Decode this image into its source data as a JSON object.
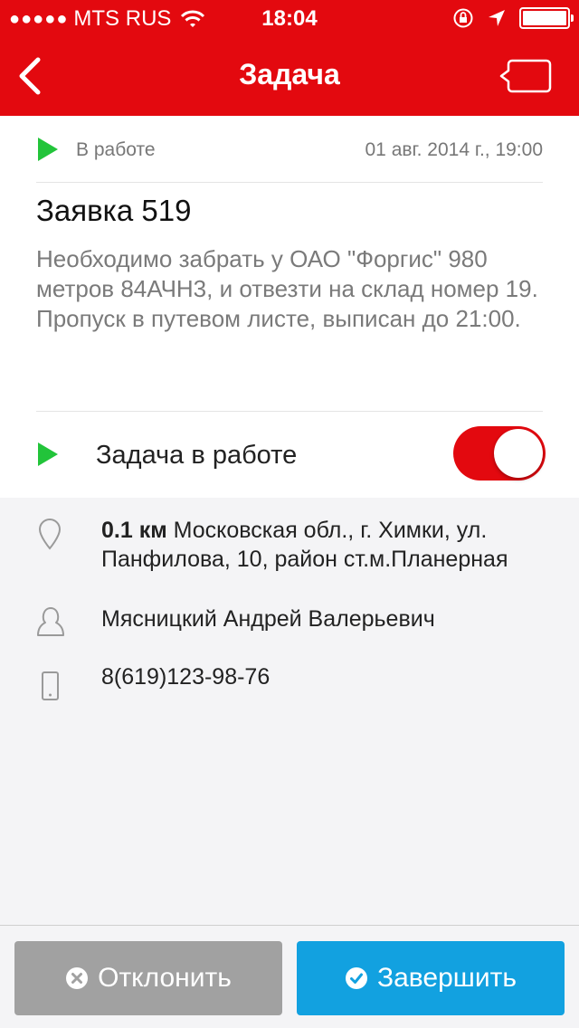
{
  "statusbar": {
    "signal": "●●●●●",
    "carrier": "MTS RUS",
    "time": "18:04"
  },
  "nav": {
    "title": "Задача"
  },
  "task": {
    "status": "В работе",
    "date": "01 авг. 2014 г., 19:00",
    "title": "Заявка 519",
    "description": "Необходимо забрать у ОАО \"Форгис\" 980 метров 84АЧН3, и отвезти на склад номер 19.\nПропуск в путевом листе, выписан до 21:00.",
    "toggle_label": "Задача в работе",
    "toggle_on": true
  },
  "details": {
    "distance": "0.1 км",
    "address": " Московская обл., г. Химки, ул. Панфилова, 10, район ст.м.Планерная",
    "person": "Мясницкий Андрей Валерьевич",
    "phone": "8(619)123-98-76"
  },
  "actions": {
    "reject_label": "Отклонить",
    "complete_label": "Завершить"
  },
  "colors": {
    "brand": "#e3090f",
    "play": "#22c43a",
    "reject": "#a1a1a1",
    "complete": "#12a1e0"
  },
  "icons": [
    "back-arrow-icon",
    "comment-icon",
    "play-icon",
    "location-pin-icon",
    "person-icon",
    "phone-icon",
    "cancel-circle-icon",
    "check-circle-icon"
  ]
}
